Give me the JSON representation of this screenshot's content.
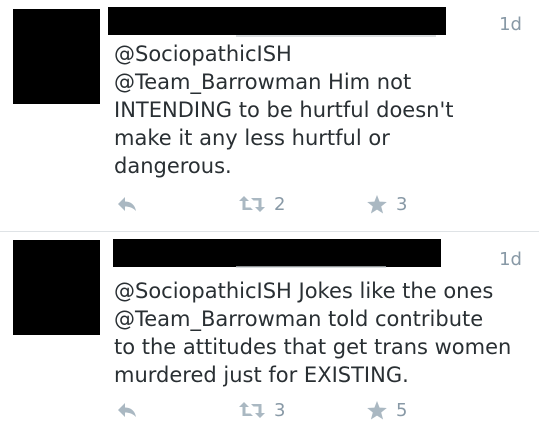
{
  "tweets": [
    {
      "timestamp": "1d",
      "text": "@SociopathicISH\n@Team_Barrowman Him not\nINTENDING to be hurtful doesn't\nmake it any less hurtful or\ndangerous.",
      "retweets": "2",
      "favorites": "3"
    },
    {
      "timestamp": "1d",
      "text": "@SociopathicISH Jokes like the ones\n@Team_Barrowman told contribute\nto the attitudes that get trans women\nmurdered just for EXISTING.",
      "retweets": "3",
      "favorites": "5"
    }
  ],
  "icons": {
    "reply": "reply-icon",
    "retweet": "retweet-icon",
    "favorite": "star-icon"
  },
  "colors": {
    "text": "#292f33",
    "meta": "#8899a6",
    "icon": "#aab8c2",
    "redaction": "#000000",
    "divider": "#dfe3e6"
  }
}
